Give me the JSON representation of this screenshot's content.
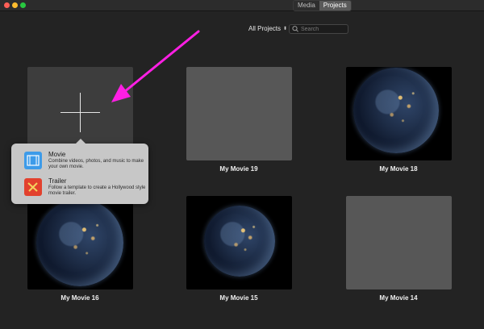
{
  "window": {
    "tabs": [
      {
        "label": "Media",
        "active": false
      },
      {
        "label": "Projects",
        "active": true
      }
    ]
  },
  "toolbar": {
    "filter_label": "All Projects",
    "search_placeholder": "Search"
  },
  "projects": [
    {
      "title": "My Movie 19",
      "thumbnail": "gray"
    },
    {
      "title": "My Movie 18",
      "thumbnail": "earth"
    },
    {
      "title": "My Movie 16",
      "thumbnail": "earth"
    },
    {
      "title": "My Movie 15",
      "thumbnail": "earth"
    },
    {
      "title": "My Movie 14",
      "thumbnail": "gray"
    }
  ],
  "new_project_menu": {
    "items": [
      {
        "title": "Movie",
        "description": "Combine videos, photos, and music to make your own movie.",
        "icon": "film-icon"
      },
      {
        "title": "Trailer",
        "description": "Follow a template to create a Hollywood style movie trailer.",
        "icon": "clapper-icon"
      }
    ]
  },
  "annotation": {
    "color": "#ff1fe4"
  },
  "colors": {
    "background": "#232323",
    "movie_icon": "#3d9be9",
    "trailer_icon": "#e2412d"
  }
}
